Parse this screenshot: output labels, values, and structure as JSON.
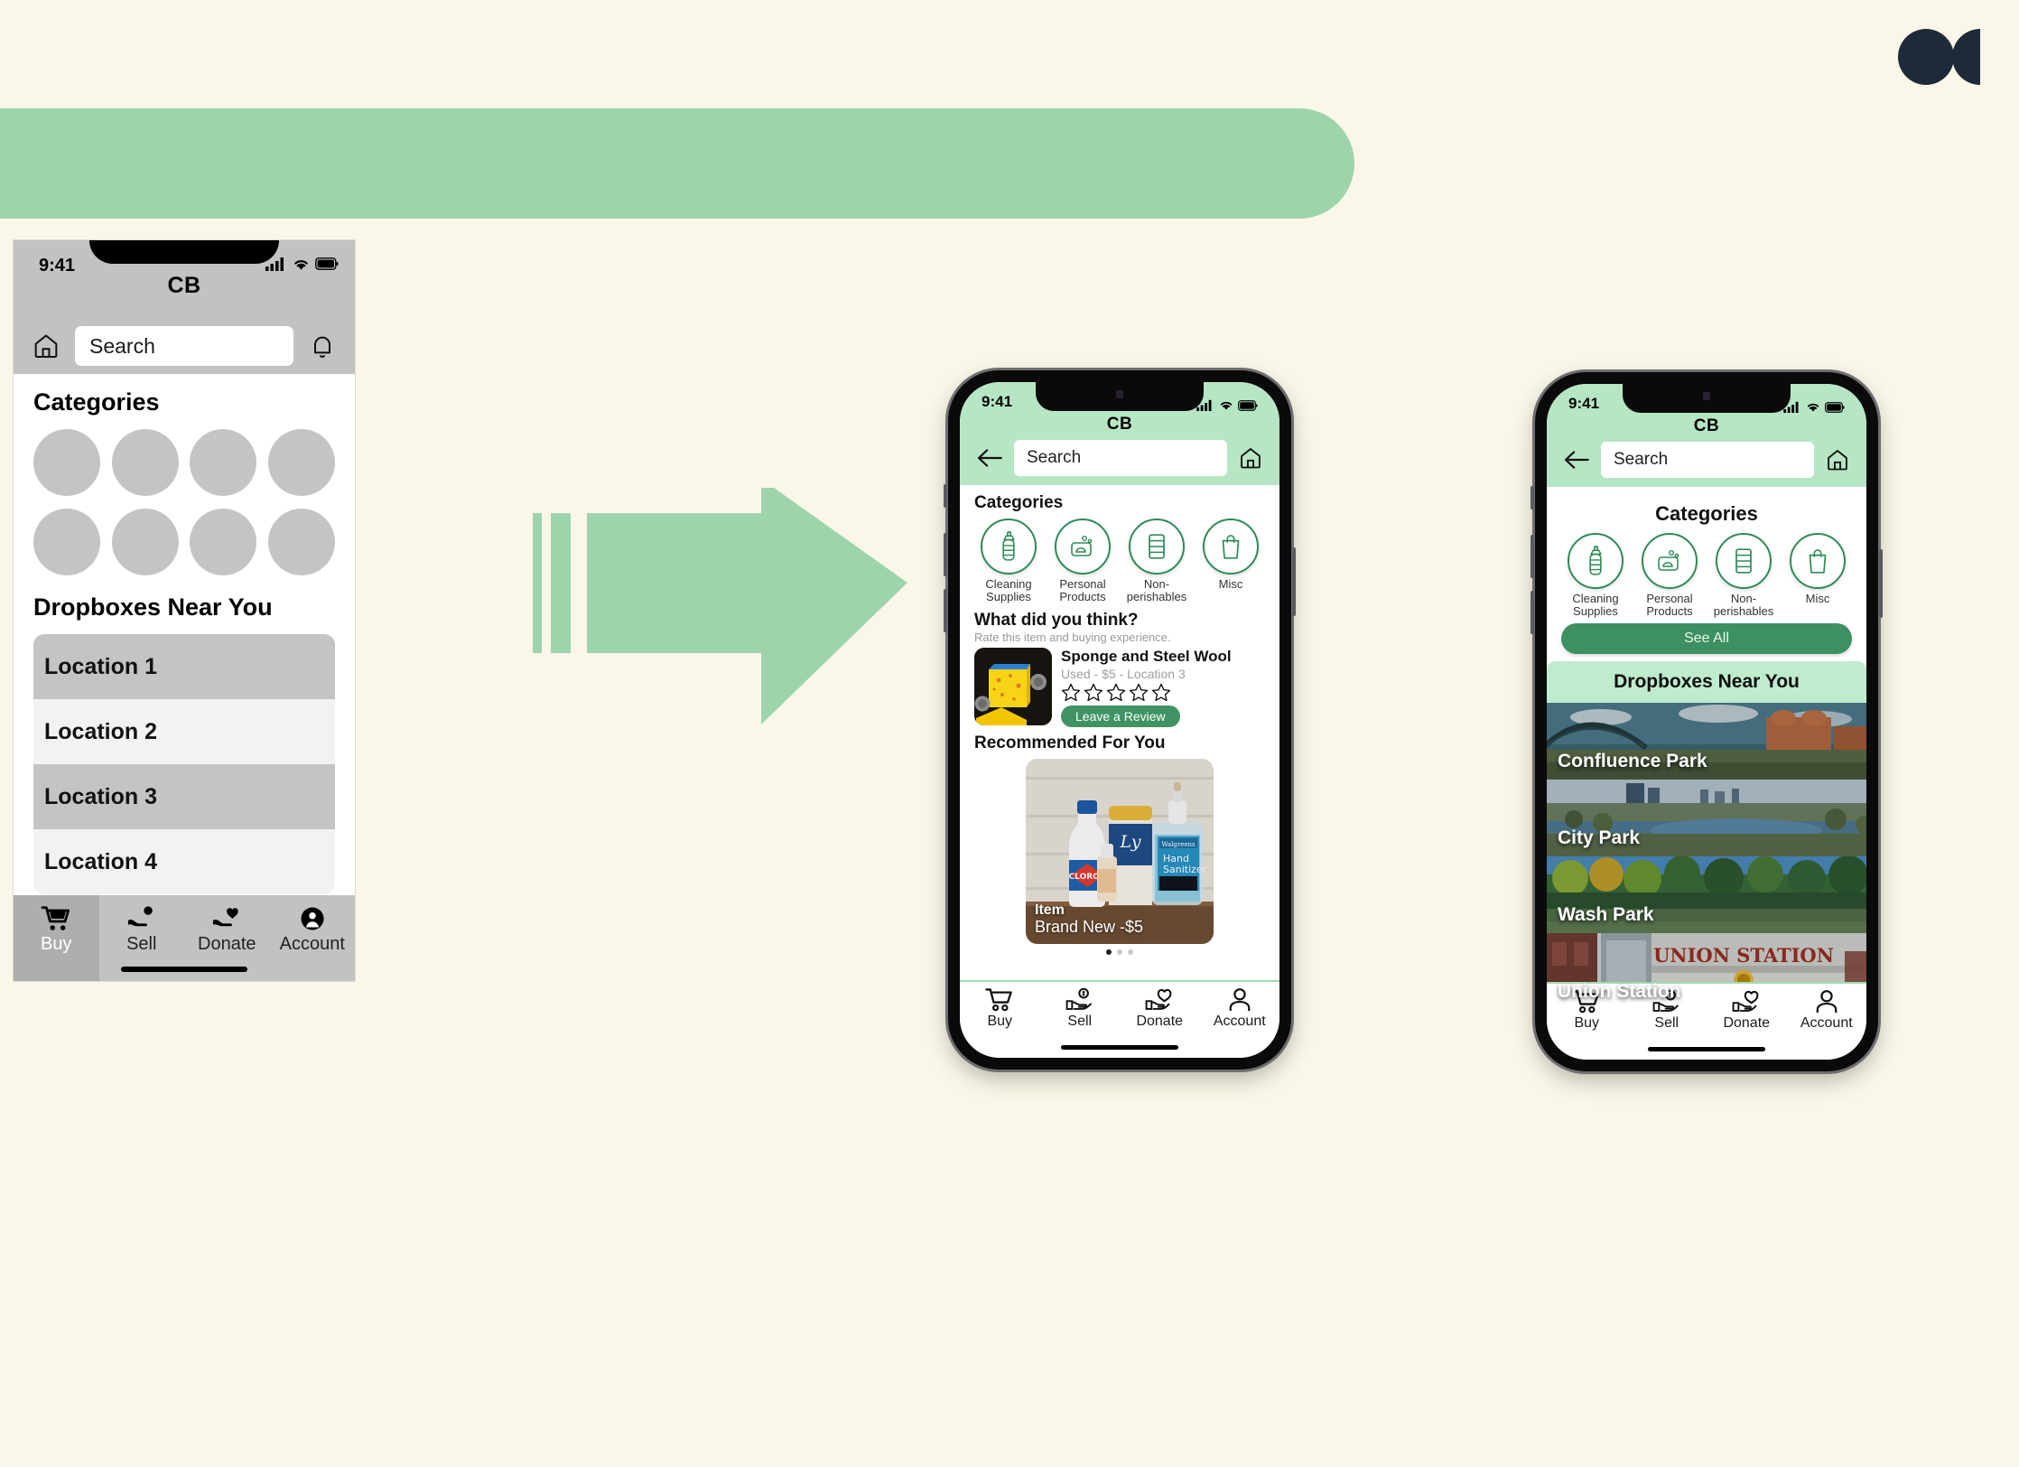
{
  "page": {
    "background_color": "#fbf7e8",
    "banner_color": "#9ed4ab",
    "accent_green": "#3d9060",
    "light_green": "#b6e6c4",
    "logo_color": "#1e2a3a",
    "logo_name": "anthropic-logo"
  },
  "arrow": {
    "name": "transition-arrow",
    "color": "#9ed4ab"
  },
  "wireframe_phone": {
    "status": {
      "time": "9:41",
      "signal_icon": "cellular-signal-icon",
      "wifi_icon": "wifi-icon",
      "battery_icon": "battery-icon"
    },
    "app_title": "CB",
    "home_icon": "home-icon",
    "bell_icon": "notification-bell-icon",
    "search": {
      "placeholder": "Search",
      "value": "Search"
    },
    "categories_heading": "Categories",
    "category_placeholders": 8,
    "dropboxes_heading": "Dropboxes Near You",
    "locations": [
      "Location 1",
      "Location 2",
      "Location 3",
      "Location 4"
    ],
    "tabs": [
      {
        "label": "Buy",
        "icon": "shopping-cart-icon",
        "active": true
      },
      {
        "label": "Sell",
        "icon": "hand-money-icon",
        "active": false
      },
      {
        "label": "Donate",
        "icon": "hand-heart-icon",
        "active": false
      },
      {
        "label": "Account",
        "icon": "user-account-icon",
        "active": false
      }
    ]
  },
  "middle_phone": {
    "status": {
      "time": "9:41",
      "signal_icon": "cellular-signal-icon",
      "wifi_icon": "wifi-icon",
      "battery_icon": "battery-icon"
    },
    "app_title": "CB",
    "back_icon": "back-arrow-icon",
    "home_icon": "home-icon",
    "search": {
      "placeholder": "Search",
      "value": "Search"
    },
    "categories_heading": "Categories",
    "categories": [
      {
        "label": "Cleaning\nSupplies",
        "label_line1": "Cleaning",
        "label_line2": "Supplies",
        "icon": "spray-bottle-icon"
      },
      {
        "label": "Personal\nProducts",
        "label_line1": "Personal",
        "label_line2": "Products",
        "icon": "soap-bar-icon"
      },
      {
        "label": "Non-\nperishables",
        "label_line1": "Non-",
        "label_line2": "perishables",
        "icon": "canned-food-icon"
      },
      {
        "label": "Misc",
        "label_line1": "Misc",
        "label_line2": "",
        "icon": "shopping-bag-icon"
      }
    ],
    "review": {
      "heading": "What did you think?",
      "subtext": "Rate this item and buying experience.",
      "item_title": "Sponge and Steel Wool",
      "item_meta": "Used - $5 - Location 3",
      "stars_total": 5,
      "stars_filled": 0,
      "button_label": "Leave a Review",
      "thumb_name": "sponge-steel-wool-photo"
    },
    "recommended": {
      "heading": "Recommended For You",
      "card_title": "Item",
      "card_subtitle": "Brand New -$5",
      "image_name": "cleaning-products-photo",
      "carousel_dots": 3,
      "carousel_active_index": 0
    },
    "tabs": [
      {
        "label": "Buy",
        "icon": "shopping-cart-icon",
        "active": false
      },
      {
        "label": "Sell",
        "icon": "hand-money-icon",
        "active": false
      },
      {
        "label": "Donate",
        "icon": "hand-heart-icon",
        "active": false
      },
      {
        "label": "Account",
        "icon": "user-account-icon",
        "active": false
      }
    ]
  },
  "right_phone": {
    "status": {
      "time": "9:41",
      "signal_icon": "cellular-signal-icon",
      "wifi_icon": "wifi-icon",
      "battery_icon": "battery-icon"
    },
    "app_title": "CB",
    "back_icon": "back-arrow-icon",
    "home_icon": "home-icon",
    "search": {
      "placeholder": "Search",
      "value": "Search"
    },
    "categories_heading": "Categories",
    "categories": [
      {
        "label_line1": "Cleaning",
        "label_line2": "Supplies",
        "icon": "spray-bottle-icon"
      },
      {
        "label_line1": "Personal",
        "label_line2": "Products",
        "icon": "soap-bar-icon"
      },
      {
        "label_line1": "Non-",
        "label_line2": "perishables",
        "icon": "canned-food-icon"
      },
      {
        "label_line1": "Misc",
        "label_line2": "",
        "icon": "shopping-bag-icon"
      }
    ],
    "see_all_label": "See All",
    "dropboxes_heading": "Dropboxes Near You",
    "dropboxes": [
      {
        "label": "Confluence Park",
        "image_name": "confluence-park-photo"
      },
      {
        "label": "City Park",
        "image_name": "city-park-photo"
      },
      {
        "label": "Wash Park",
        "image_name": "wash-park-photo"
      },
      {
        "label": "Union Station",
        "image_name": "union-station-photo"
      }
    ],
    "tabs": [
      {
        "label": "Buy",
        "icon": "shopping-cart-icon",
        "active": false
      },
      {
        "label": "Sell",
        "icon": "hand-money-icon",
        "active": false
      },
      {
        "label": "Donate",
        "icon": "hand-heart-icon",
        "active": false
      },
      {
        "label": "Account",
        "icon": "user-account-icon",
        "active": false
      }
    ]
  }
}
